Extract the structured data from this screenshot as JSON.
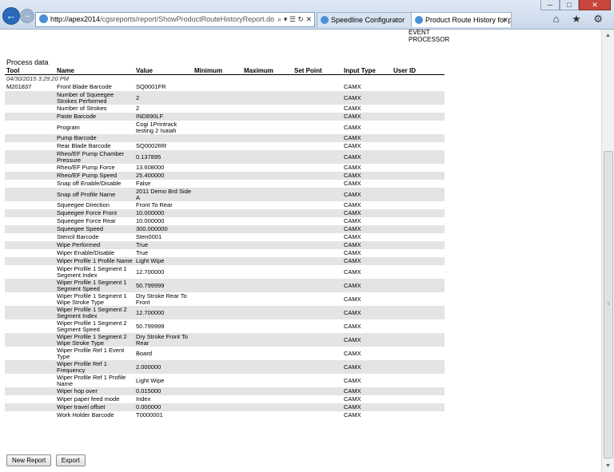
{
  "browser": {
    "url_host": "http://apex2014",
    "url_rest": "/cgsreports/report/ShowProductRouteHistoryReport.do",
    "addr_actions": "⌕ ▾ ☰ ↻ ✕",
    "tabs": [
      {
        "label": "Speedline Configurator"
      },
      {
        "label": "Product Route History for p..."
      }
    ],
    "tab_close": "✕",
    "window_buttons": {
      "min": "─",
      "max": "□",
      "close": "✕"
    },
    "right_icons": "⌂ ★ ⚙"
  },
  "page": {
    "event_label": "EVENT PROCESSOR",
    "section_title": "Process data",
    "columns": [
      "Tool",
      "Name",
      "Value",
      "Minimum",
      "Maximum",
      "Set Point",
      "Input Type",
      "User ID"
    ],
    "timestamp": "04/30/2015 3:29:20 PM",
    "tool": "M201837",
    "rows": [
      {
        "name": "Front Blade Barcode",
        "value": "SQ0001FR",
        "input": "CAMX"
      },
      {
        "name": "Number of Squeegee Strokes Performed",
        "value": "2",
        "input": "CAMX"
      },
      {
        "name": "Number of Strokes",
        "value": "2",
        "input": "CAMX"
      },
      {
        "name": "Paste Barcode",
        "value": "IND890LF",
        "input": "CAMX"
      },
      {
        "name": "Program",
        "value": "Cogi 1Printrack testing 2 Isaiah",
        "input": "CAMX"
      },
      {
        "name": "Pump Barcode",
        "value": "",
        "input": "CAMX"
      },
      {
        "name": "Rear Blade Barcode",
        "value": "SQ0002RR",
        "input": "CAMX"
      },
      {
        "name": "Rheo/EF Pump Chamber Pressure",
        "value": "0.137895",
        "input": "CAMX"
      },
      {
        "name": "Rheo/EF Pump Force",
        "value": "13.608000",
        "input": "CAMX"
      },
      {
        "name": "Rheo/EF Pump Speed",
        "value": "25.400000",
        "input": "CAMX"
      },
      {
        "name": "Snap off Enable/Disable",
        "value": "False",
        "input": "CAMX"
      },
      {
        "name": "Snap off Profile Name",
        "value": "2011 Demo Brd Side A",
        "input": "CAMX"
      },
      {
        "name": "Squeegee Direction",
        "value": "Front To Rear",
        "input": "CAMX"
      },
      {
        "name": "Squeegee Force Front",
        "value": "10.000000",
        "input": "CAMX"
      },
      {
        "name": "Squeegee Force Rear",
        "value": "10.000000",
        "input": "CAMX"
      },
      {
        "name": "Squeegee Speed",
        "value": "300.000000",
        "input": "CAMX"
      },
      {
        "name": "Stencil Barcode",
        "value": "Sten0001",
        "input": "CAMX"
      },
      {
        "name": "Wipe Performed",
        "value": "True",
        "input": "CAMX"
      },
      {
        "name": "Wiper Enable/Disable",
        "value": "True",
        "input": "CAMX"
      },
      {
        "name": "Wiper Profile 1 Profile Name",
        "value": "Light Wipe",
        "input": "CAMX"
      },
      {
        "name": "Wiper Profile 1 Segment 1 Segment Index",
        "value": "12.700000",
        "input": "CAMX"
      },
      {
        "name": "Wiper Profile 1 Segment 1 Segment Speed",
        "value": "50.799999",
        "input": "CAMX"
      },
      {
        "name": "Wiper Profile 1 Segment 1 Wipe Stroke Type",
        "value": "Dry Stroke Rear To Front",
        "input": "CAMX"
      },
      {
        "name": "Wiper Profile 1 Segment 2 Segment Index",
        "value": "12.700000",
        "input": "CAMX"
      },
      {
        "name": "Wiper Profile 1 Segment 2 Segment Speed",
        "value": "50.799999",
        "input": "CAMX"
      },
      {
        "name": "Wiper Profile 1 Segment 2 Wipe Stroke Type",
        "value": "Dry Stroke Front To Rear",
        "input": "CAMX"
      },
      {
        "name": "Wiper Profile Ref 1 Event Type",
        "value": "Board",
        "input": "CAMX"
      },
      {
        "name": "Wiper Profile Ref 1 Frequency",
        "value": "2.000000",
        "input": "CAMX"
      },
      {
        "name": "Wiper Profile Ref 1 Profile Name",
        "value": "Light Wipe",
        "input": "CAMX"
      },
      {
        "name": "Wiper hop over",
        "value": "0.015000",
        "input": "CAMX"
      },
      {
        "name": "Wiper paper feed mode",
        "value": "Index",
        "input": "CAMX"
      },
      {
        "name": "Wiper travel offset",
        "value": "0.000000",
        "input": "CAMX"
      },
      {
        "name": "Work Holder Barcode",
        "value": "T0000001",
        "input": "CAMX"
      }
    ],
    "buttons": {
      "new_report": "New Report",
      "export": "Export"
    }
  },
  "scrollbar": {
    "up": "▲",
    "down": "▼",
    "grip": "≡"
  }
}
